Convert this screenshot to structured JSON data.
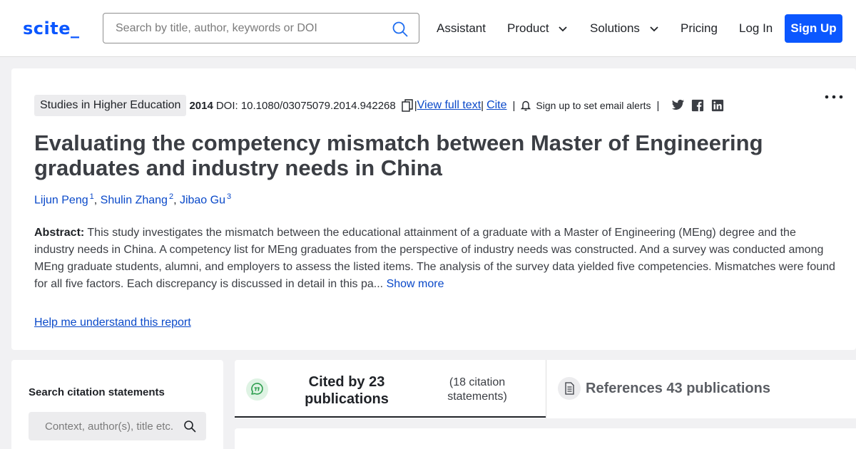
{
  "header": {
    "logo": "scite_",
    "search_placeholder": "Search by title, author, keywords or DOI",
    "nav": {
      "assistant": "Assistant",
      "product": "Product",
      "solutions": "Solutions",
      "pricing": "Pricing",
      "login": "Log In",
      "signup": "Sign Up"
    }
  },
  "paper": {
    "journal": "Studies in Higher Education",
    "year": "2014",
    "doi": "DOI: 10.1080/03075079.2014.942268",
    "view_full_text": "View full text",
    "cite": "Cite",
    "email_alerts": "Sign up to set email alerts",
    "title": "Evaluating the competency mismatch between Master of Engineering graduates and industry needs in China",
    "authors": [
      {
        "name": "Lijun Peng",
        "sup": "1"
      },
      {
        "name": "Shulin Zhang",
        "sup": "2"
      },
      {
        "name": "Jibao Gu",
        "sup": "3"
      }
    ],
    "abstract_label": "Abstract:",
    "abstract_text": "This study investigates the mismatch between the educational attainment of a graduate with a Master of Engineering (MEng) degree and the industry needs in China. A competency list for MEng graduates from the perspective of industry needs was constructed. And a survey was conducted among MEng graduate students, alumni, and employers to assess the listed items. The analysis of the survey data yielded five competencies. Mismatches were found for all five factors. Each discrepancy is discussed in detail in this pa...",
    "show_more": "Show more",
    "help_link": "Help me understand this report"
  },
  "sidebar": {
    "title": "Search citation statements",
    "placeholder": "Context, author(s), title etc."
  },
  "tabs": {
    "cited_label": "Cited by 23 publications",
    "cited_statements": "(18 citation statements)",
    "references_label": "References 43 publications"
  },
  "colors": {
    "brand": "#0b57ff",
    "link": "#0a49c9",
    "quote_icon_green": "#2e9e4f"
  },
  "icons": [
    "search-icon",
    "chevron-down-icon",
    "copy-icon",
    "bell-icon",
    "twitter-icon",
    "facebook-icon",
    "linkedin-icon",
    "more-options-icon",
    "quote-icon",
    "document-icon"
  ]
}
